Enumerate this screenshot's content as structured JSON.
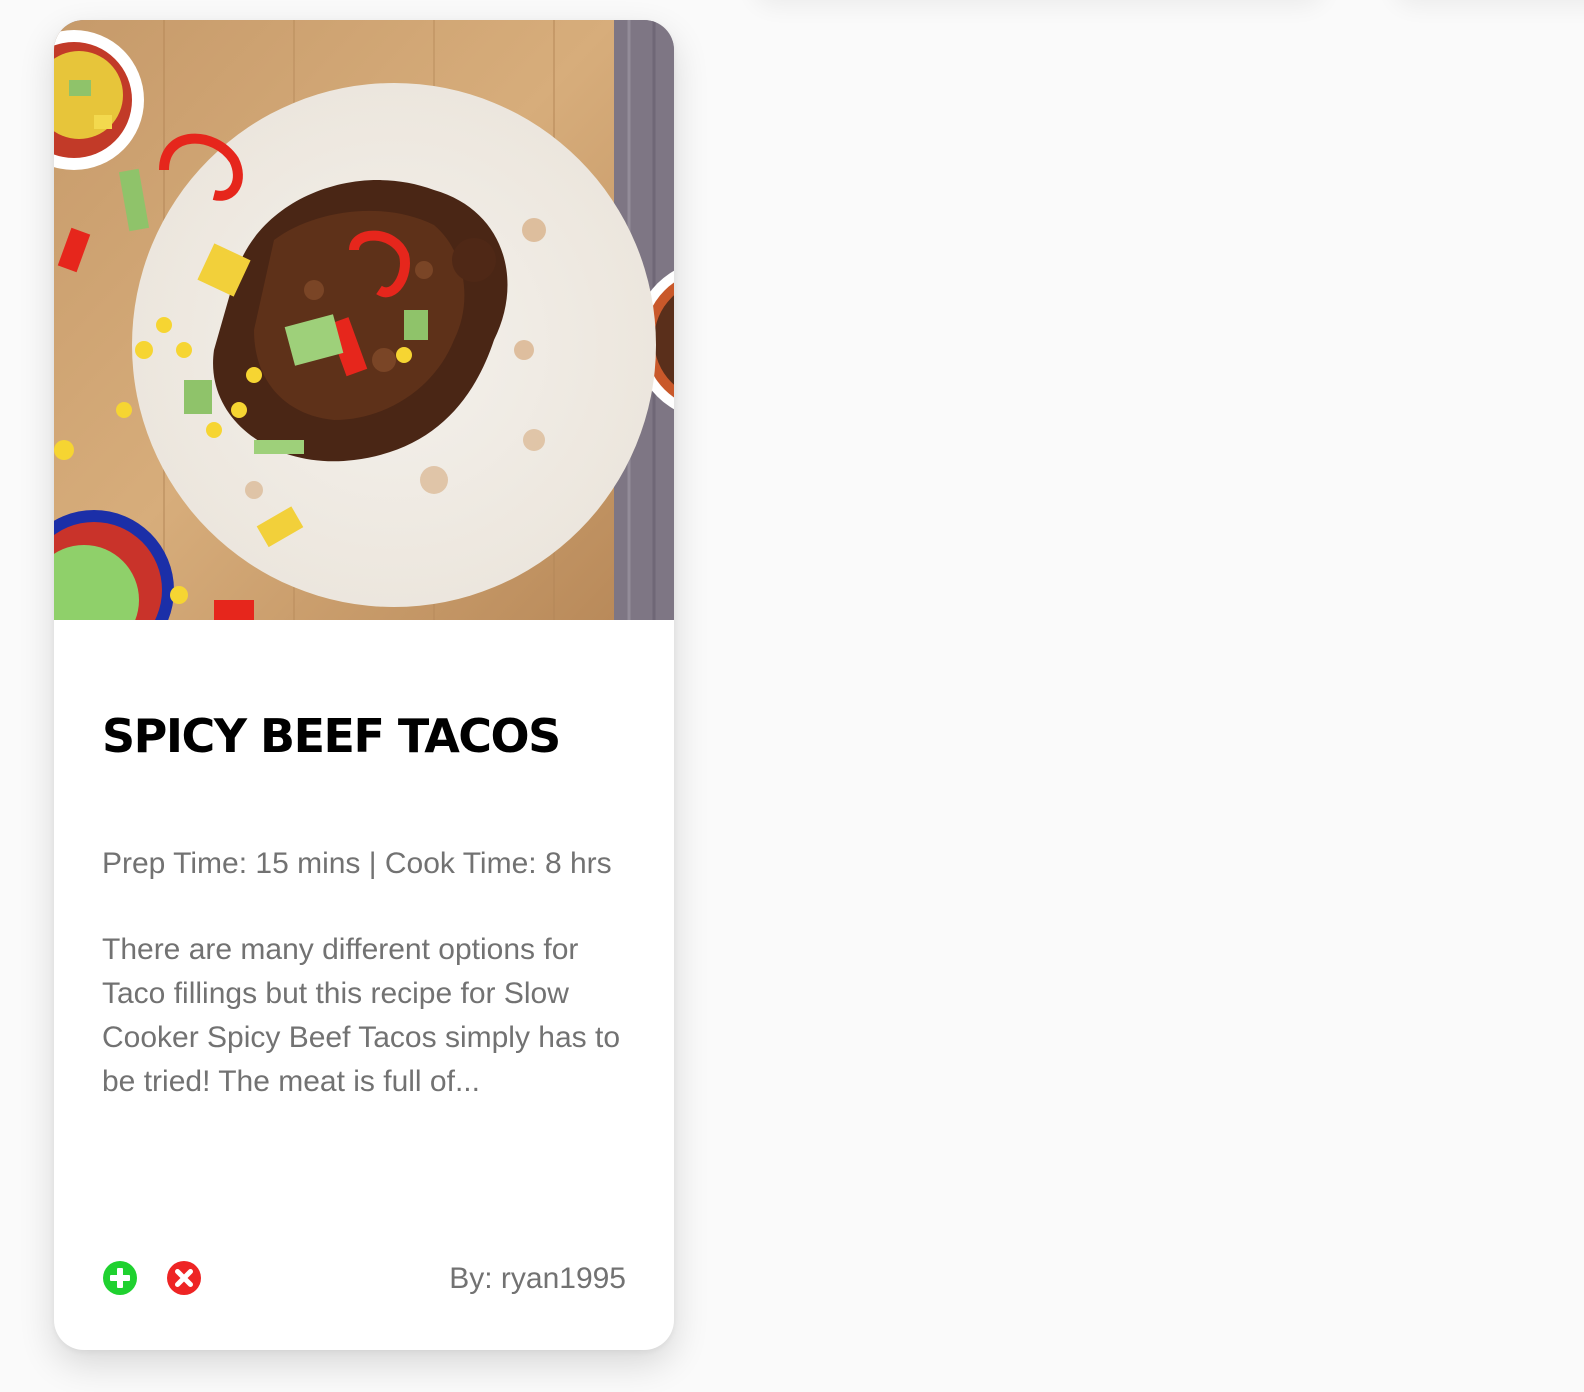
{
  "recipe": {
    "title": "SPICY BEEF TACOS",
    "meta": "Prep Time: 15 mins | Cook Time: 8 hrs",
    "description": "There are many different options for Taco fillings but this recipe for Slow Cooker Spicy Beef Tacos simply has to be tried! The meat is full of...",
    "author": "By: ryan1995"
  },
  "icons": {
    "add": "plus-circle-icon",
    "remove": "x-circle-icon"
  },
  "colors": {
    "add": "#1fd12f",
    "remove": "#ee2424",
    "text_muted": "#727272",
    "title": "#000000"
  }
}
